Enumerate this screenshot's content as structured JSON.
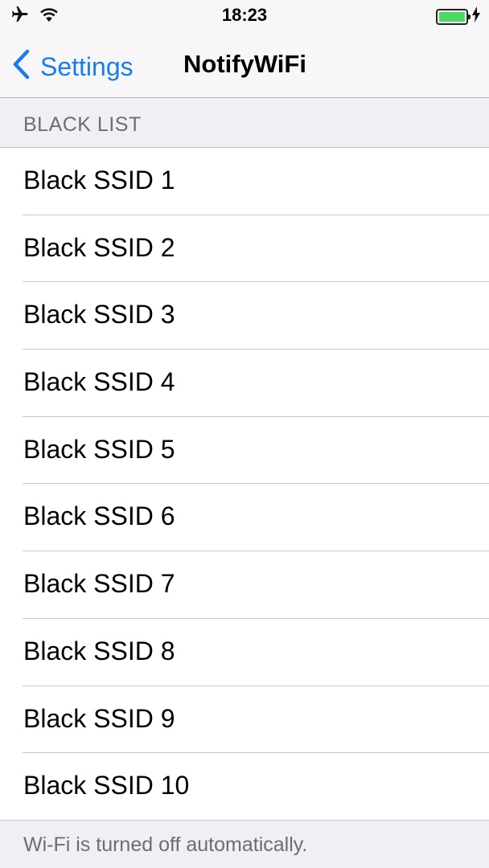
{
  "status_bar": {
    "time": "18:23",
    "icons": [
      "airplane-icon",
      "wifi-icon",
      "battery-icon",
      "charging-bolt-icon"
    ],
    "battery_level": 1.0,
    "battery_color": "#4cd964"
  },
  "nav_bar": {
    "back_label": "Settings",
    "title": "NotifyWiFi",
    "accent": "#1a7cf0"
  },
  "section": {
    "header": "BLACK LIST",
    "items": [
      {
        "label": "Black SSID 1"
      },
      {
        "label": "Black SSID 2"
      },
      {
        "label": "Black SSID 3"
      },
      {
        "label": "Black SSID 4"
      },
      {
        "label": "Black SSID 5"
      },
      {
        "label": "Black SSID 6"
      },
      {
        "label": "Black SSID 7"
      },
      {
        "label": "Black SSID 8"
      },
      {
        "label": "Black SSID 9"
      },
      {
        "label": "Black SSID 10"
      }
    ],
    "footer": "Wi-Fi is turned off automatically."
  }
}
